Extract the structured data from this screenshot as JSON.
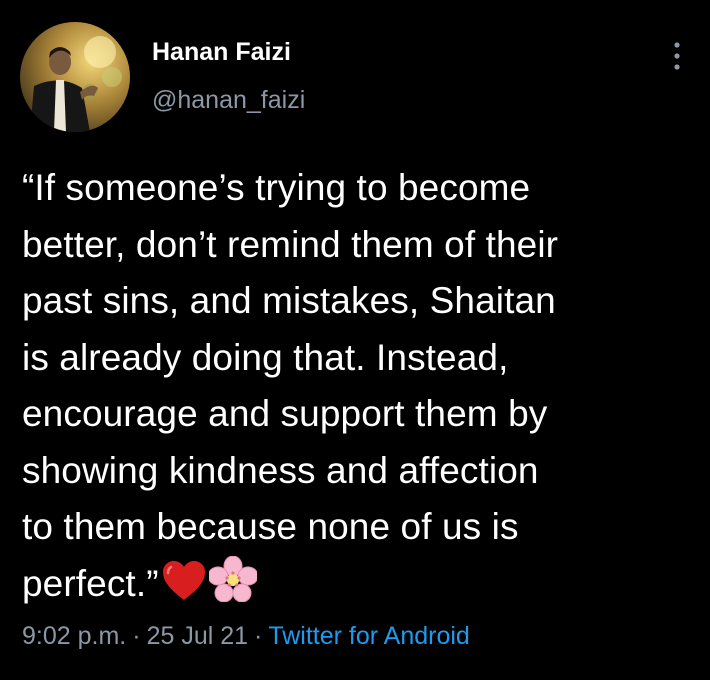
{
  "author": {
    "name": "Hanan Faizi",
    "handle": "@hanan_faizi",
    "avatar_icon": "profile-photo"
  },
  "menu": {
    "icon": "more-vertical-icon"
  },
  "tweet": {
    "lines": [
      "“If someone’s trying to become",
      "better, don’t remind them of their",
      "past sins, and mistakes, Shaitan",
      "is already doing that. Instead,",
      "encourage and support them by",
      "showing kindness and affection",
      "to them because none of us is",
      "perfect.”"
    ],
    "emojis": [
      "red-heart-icon",
      "cherry-blossom-icon"
    ]
  },
  "meta": {
    "time": "9:02 p.m.",
    "separator": "·",
    "date": "25 Jul 21",
    "source": "Twitter for Android"
  },
  "colors": {
    "background": "#000000",
    "text": "#ffffff",
    "secondary": "#8b98a5",
    "link": "#1d9bf0"
  }
}
